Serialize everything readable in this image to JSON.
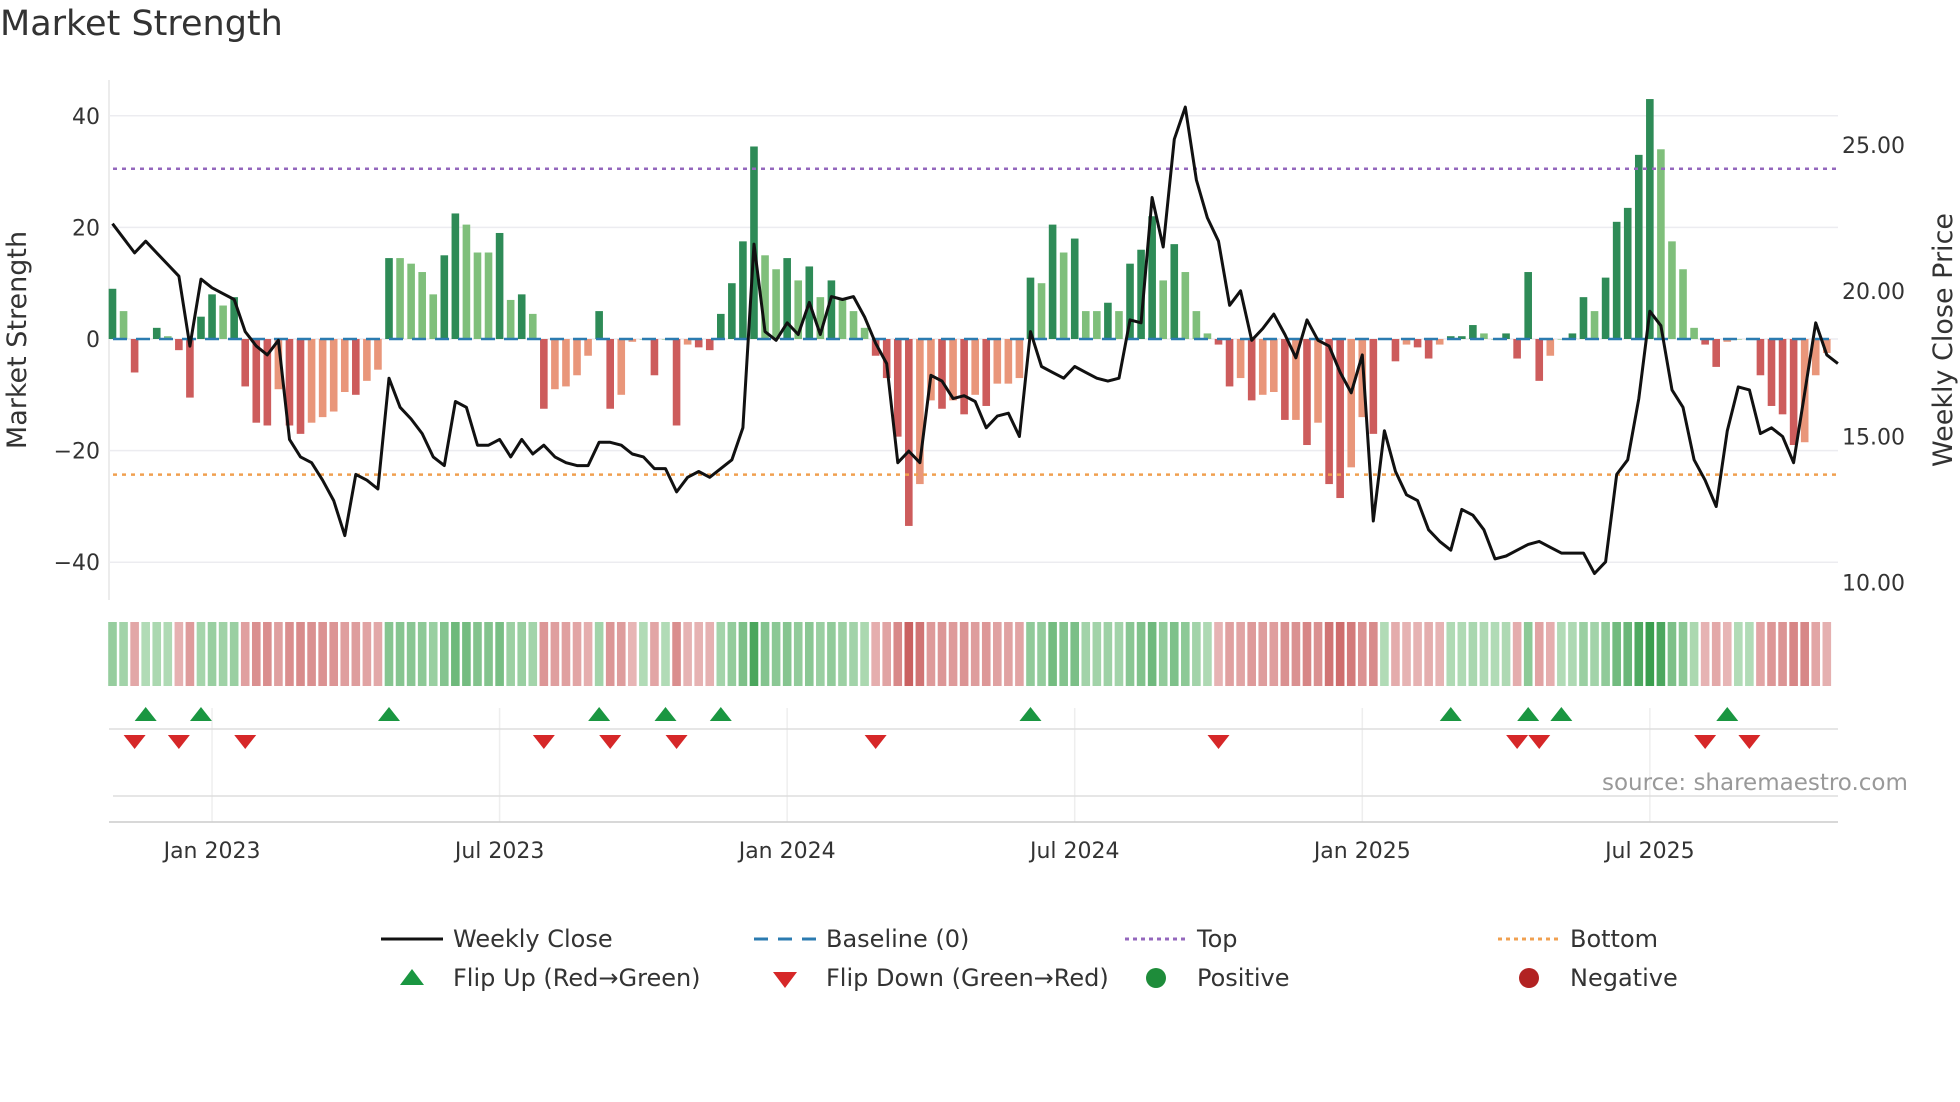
{
  "title": "Market Strength",
  "source": "source: sharemaestro.com",
  "colors": {
    "pos_strong": "#2e8b57",
    "pos_weak": "#7fbf7b",
    "neg_strong": "#cd5c5c",
    "neg_weak": "#e9967a",
    "baseline": "#2b7bb0",
    "top": "#9467bd",
    "bottom": "#f0a050",
    "line": "#111111",
    "flip_up": "#1a9641",
    "flip_down": "#d62728",
    "positive": "#1e8c3a",
    "negative": "#b22222"
  },
  "legend": [
    {
      "label": "Weekly Close",
      "icon": "line-solid"
    },
    {
      "label": "Baseline (0)",
      "icon": "line-dashed"
    },
    {
      "label": "Top",
      "icon": "line-dotted-purple"
    },
    {
      "label": "Bottom",
      "icon": "line-dotted-orange"
    },
    {
      "label": "Flip Up (Red→Green)",
      "icon": "triangle-up"
    },
    {
      "label": "Flip Down (Green→Red)",
      "icon": "triangle-down"
    },
    {
      "label": "Positive",
      "icon": "circle-green"
    },
    {
      "label": "Negative",
      "icon": "circle-red"
    }
  ],
  "chart_data": {
    "type": "bar+line",
    "title": "Market Strength",
    "ylabel": "Market Strength",
    "y2label": "Weekly Close Price",
    "ylim": [
      -47,
      47
    ],
    "y2lim": [
      9.3,
      27.3
    ],
    "yticks": [
      40,
      20,
      0,
      -20,
      -40
    ],
    "ytick_labels": [
      "40",
      "20",
      "0",
      "−20",
      "−40"
    ],
    "y2ticks": [
      25,
      20,
      15,
      10
    ],
    "y2tick_labels": [
      "25.00",
      "20.00",
      "15.00",
      "10.00"
    ],
    "xtick_labels": [
      "Jan 2023",
      "Jul 2023",
      "Jan 2024",
      "Jul 2024",
      "Jan 2025",
      "Jul 2025"
    ],
    "xtick_weeks": [
      9,
      35,
      61,
      87,
      113,
      139
    ],
    "top_level": 30.5,
    "bottom_level": -24.3,
    "strength": [
      9,
      5,
      -6,
      0,
      2,
      0.5,
      -2,
      -10.5,
      4,
      8,
      6,
      7.5,
      -8.5,
      -15,
      -15.5,
      -9,
      -15.5,
      -17,
      -15,
      -14,
      -13,
      -9.5,
      -10,
      -7.5,
      -5.5,
      14.5,
      14.5,
      13.5,
      12,
      8,
      15,
      22.5,
      20.5,
      15.5,
      15.5,
      19,
      7,
      8,
      4.5,
      -12.5,
      -9,
      -8.5,
      -6.5,
      -3,
      5,
      -12.5,
      -10,
      -0.5,
      0,
      -6.5,
      0,
      -15.5,
      -1,
      -1.5,
      -2,
      4.5,
      10,
      17.5,
      34.5,
      15,
      12.5,
      14.5,
      10.5,
      13,
      7.5,
      10.5,
      7,
      5,
      2,
      -3,
      -7,
      -17.5,
      -33.5,
      -26,
      -11,
      -12.5,
      -11,
      -13.5,
      -10,
      -12,
      -8,
      -8,
      -7,
      11,
      10,
      20.5,
      15.5,
      18,
      5,
      5,
      6.5,
      5,
      13.5,
      16,
      22,
      10.5,
      17,
      12,
      5,
      1,
      -1,
      -8.5,
      -7,
      -11,
      -10,
      -9.5,
      -14.5,
      -14.5,
      -19,
      -15,
      -26,
      -28.5,
      -23,
      -14,
      -17,
      0,
      -4,
      -1,
      -1.5,
      -3.5,
      -1,
      0.5,
      0.5,
      2.5,
      1,
      0,
      1,
      -3.5,
      12,
      -7.5,
      -3,
      0,
      1,
      7.5,
      5,
      11,
      21,
      23.5,
      33,
      43,
      34,
      17.5,
      12.5,
      2,
      -1,
      -5,
      -0.5,
      0,
      0,
      -6.5,
      -12,
      -13.5,
      -19,
      -18.5,
      -6.5,
      -2.5
    ],
    "strong": [
      1,
      0,
      1,
      0,
      1,
      0,
      1,
      1,
      1,
      1,
      0,
      1,
      1,
      1,
      1,
      0,
      1,
      1,
      0,
      0,
      0,
      0,
      1,
      0,
      0,
      1,
      0,
      0,
      0,
      0,
      1,
      1,
      0,
      0,
      0,
      1,
      0,
      1,
      0,
      1,
      0,
      0,
      0,
      0,
      1,
      1,
      0,
      0,
      0,
      1,
      0,
      1,
      0,
      1,
      1,
      1,
      1,
      1,
      1,
      0,
      0,
      1,
      0,
      1,
      0,
      1,
      0,
      0,
      0,
      1,
      1,
      1,
      1,
      0,
      0,
      1,
      0,
      1,
      0,
      1,
      0,
      0,
      0,
      1,
      0,
      1,
      0,
      1,
      0,
      0,
      1,
      0,
      1,
      1,
      1,
      0,
      1,
      0,
      0,
      0,
      1,
      1,
      0,
      1,
      0,
      0,
      1,
      0,
      1,
      0,
      1,
      1,
      0,
      0,
      1,
      0,
      1,
      0,
      1,
      1,
      0,
      1,
      1,
      1,
      0,
      0,
      1,
      1,
      1,
      1,
      0,
      0,
      1,
      1,
      0,
      1,
      1,
      1,
      1,
      1,
      0,
      0,
      0,
      0,
      1,
      1,
      0,
      0,
      0,
      1,
      1,
      1,
      1,
      0,
      0,
      0
    ],
    "weekly_close": [
      22.3,
      21.8,
      21.3,
      21.7,
      21.3,
      20.9,
      20.5,
      18.1,
      20.4,
      20.1,
      19.9,
      19.7,
      18.6,
      18.1,
      17.8,
      18.3,
      14.9,
      14.3,
      14.1,
      13.5,
      12.8,
      11.6,
      13.7,
      13.5,
      13.2,
      17.0,
      16.0,
      15.6,
      15.1,
      14.3,
      14.0,
      16.2,
      16.0,
      14.7,
      14.7,
      14.9,
      14.3,
      14.9,
      14.4,
      14.7,
      14.3,
      14.1,
      14.0,
      14.0,
      14.8,
      14.8,
      14.7,
      14.4,
      14.3,
      13.9,
      13.9,
      13.1,
      13.6,
      13.8,
      13.6,
      13.9,
      14.2,
      15.3,
      21.6,
      18.6,
      18.3,
      18.9,
      18.5,
      19.6,
      18.5,
      19.8,
      19.7,
      19.8,
      19.1,
      18.2,
      17.5,
      14.1,
      14.5,
      14.1,
      17.1,
      16.9,
      16.3,
      16.4,
      16.2,
      15.3,
      15.7,
      15.8,
      15.0,
      18.6,
      17.4,
      17.2,
      17.0,
      17.4,
      17.2,
      17.0,
      16.9,
      17.0,
      19.0,
      18.9,
      23.2,
      21.5,
      25.2,
      26.3,
      23.8,
      22.5,
      21.7,
      19.5,
      20.0,
      18.3,
      18.7,
      19.2,
      18.5,
      17.7,
      19.0,
      18.3,
      18.1,
      17.2,
      16.5,
      17.8,
      12.1,
      15.2,
      13.8,
      13.0,
      12.8,
      11.8,
      11.4,
      11.1,
      12.5,
      12.3,
      11.8,
      10.8,
      10.9,
      11.1,
      11.3,
      11.4,
      11.2,
      11.0,
      11.0,
      11.0,
      10.3,
      10.7,
      13.7,
      14.2,
      16.3,
      19.3,
      18.8,
      16.6,
      16.0,
      14.2,
      13.5,
      12.6,
      15.2,
      16.7,
      16.6,
      15.1,
      15.3,
      15.0,
      14.1,
      16.5,
      18.9,
      17.8,
      17.5
    ],
    "flip_up_weeks": [
      3,
      8,
      25,
      44,
      50,
      55,
      83,
      121,
      128,
      131,
      146
    ],
    "flip_down_weeks": [
      2,
      6,
      12,
      39,
      45,
      51,
      69,
      100,
      127,
      129,
      144,
      148
    ],
    "legend_placement": "bottom"
  }
}
